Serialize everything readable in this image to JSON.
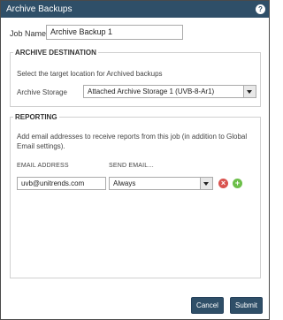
{
  "dialog": {
    "title": "Archive Backups",
    "help_icon": "?"
  },
  "job": {
    "label": "Job Name",
    "value": "Archive Backup 1"
  },
  "archive_destination": {
    "legend": "ARCHIVE DESTINATION",
    "description": "Select the target location for Archived backups",
    "storage_label": "Archive Storage",
    "storage_value": "Attached Archive Storage 1 (UVB-8-Ar1)"
  },
  "reporting": {
    "legend": "REPORTING",
    "description": "Add email addresses to receive reports from this job (in addition to Global Email settings).",
    "col_email": "EMAIL ADDRESS",
    "col_send": "SEND EMAIL...",
    "rows": [
      {
        "email": "uvb@unitrends.com",
        "send": "Always"
      }
    ]
  },
  "buttons": {
    "cancel": "Cancel",
    "submit": "Submit"
  }
}
